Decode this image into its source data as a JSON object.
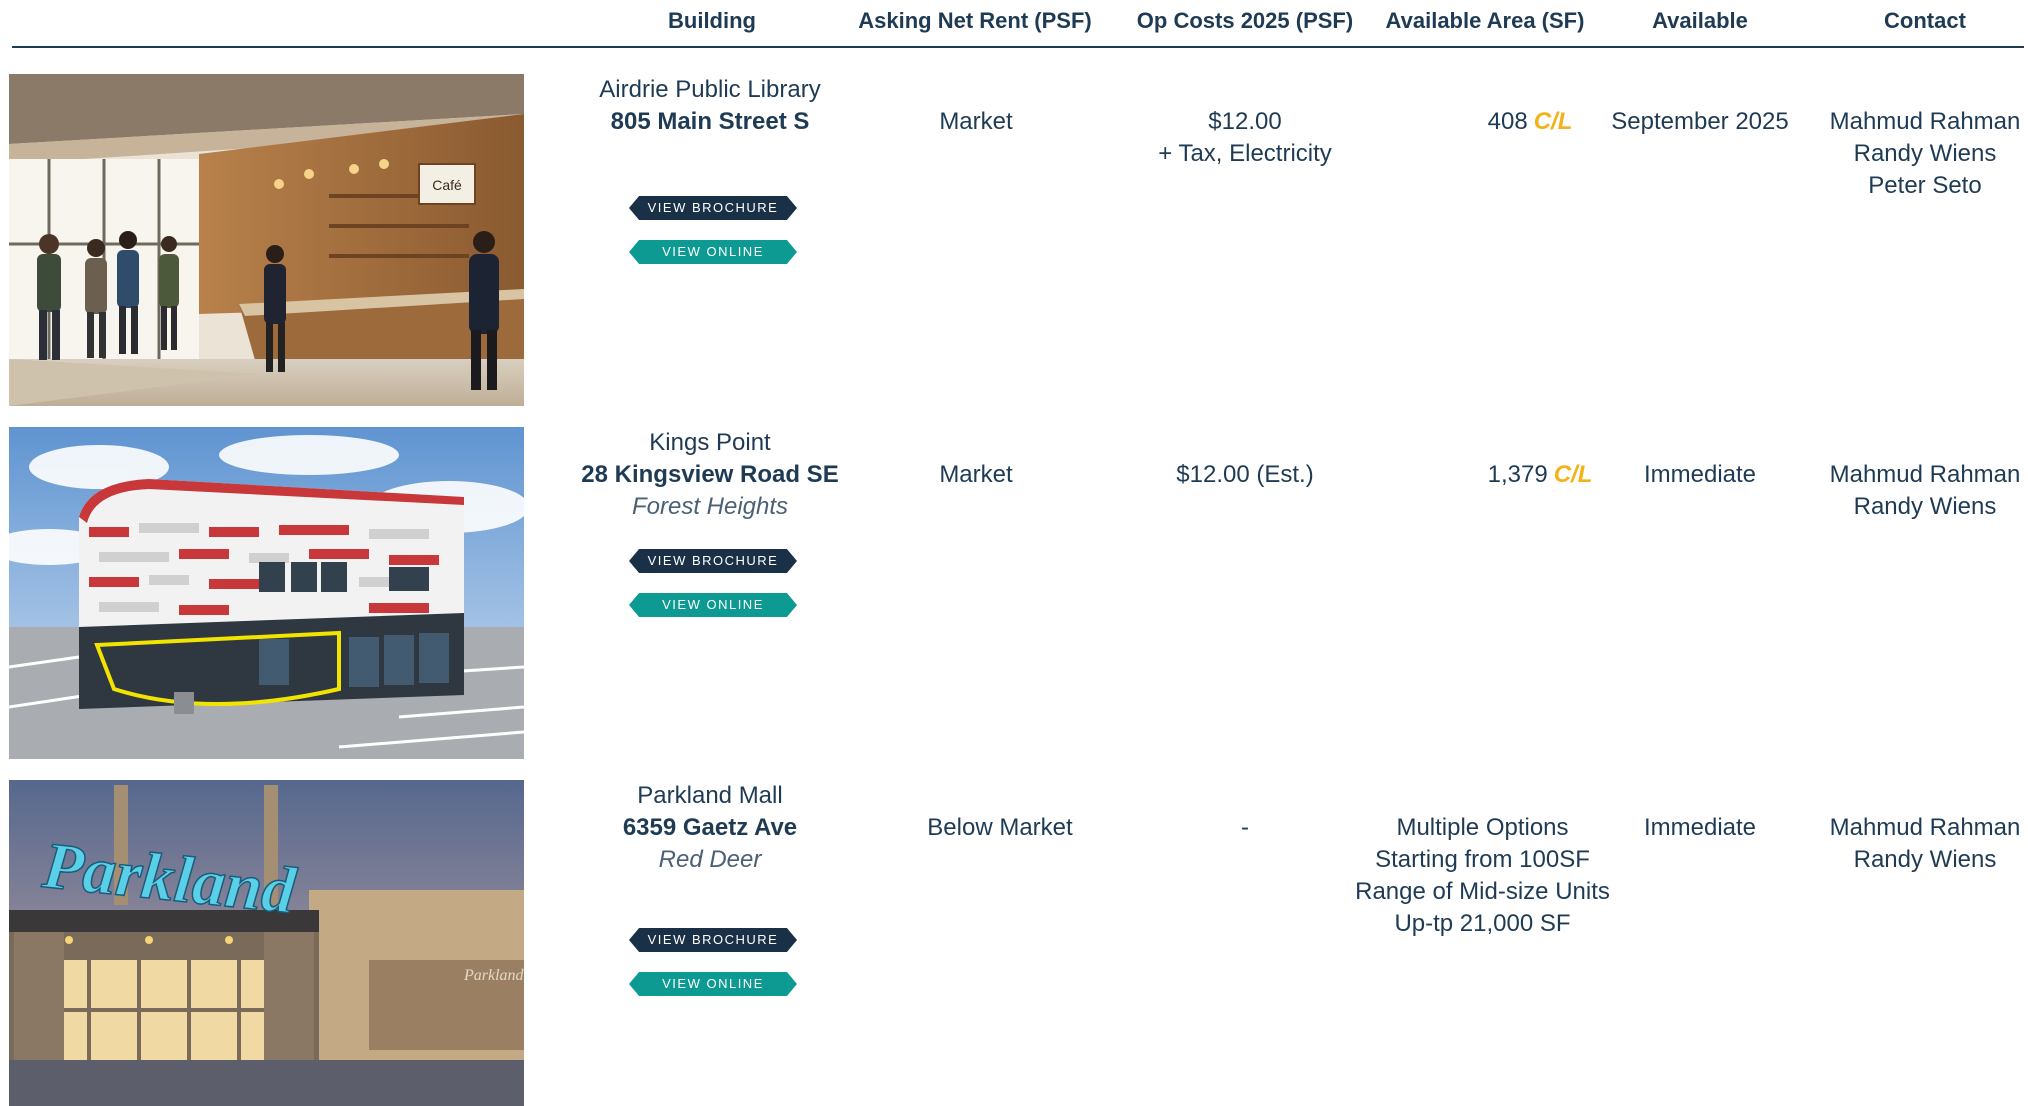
{
  "header": {
    "building": "Building",
    "rent": "Asking Net Rent (PSF)",
    "opcosts": "Op Costs 2025 (PSF)",
    "area": "Available Area (SF)",
    "available": "Available",
    "contact": "Contact"
  },
  "buttons": {
    "brochure": "VIEW BROCHURE",
    "online": "VIEW ONLINE"
  },
  "cl_badge": "C/L",
  "photo_text": {
    "parkland_sign": "Parkland",
    "cafe_sign": "Café"
  },
  "listings": [
    {
      "name": "Airdrie Public Library",
      "address": "805 Main Street S",
      "area_name": "",
      "rent": "Market",
      "opcost_1": "$12.00",
      "opcost_2": "+ Tax, Electricity",
      "area_sf": "408",
      "available": "September 2025",
      "contacts": [
        "Mahmud Rahman",
        "Randy Wiens",
        "Peter Seto"
      ]
    },
    {
      "name": "Kings Point",
      "address": "28 Kingsview Road SE",
      "area_name": "Forest Heights",
      "rent": "Market",
      "opcost_1": "$12.00 (Est.)",
      "opcost_2": "",
      "area_sf": "1,379",
      "available": "Immediate",
      "contacts": [
        "Mahmud Rahman",
        "Randy Wiens"
      ]
    },
    {
      "name": "Parkland Mall",
      "address": "6359 Gaetz Ave",
      "area_name": "Red Deer",
      "rent": "Below Market",
      "opcost_1": "-",
      "opcost_2": "",
      "area_lines": [
        "Multiple Options",
        "Starting from 100SF",
        "Range of Mid-size Units",
        "Up-tp 21,000 SF"
      ],
      "available": "Immediate",
      "contacts": [
        "Mahmud Rahman",
        "Randy Wiens"
      ]
    }
  ],
  "colors": {
    "navy": "#1f3b54",
    "teal": "#0d9a92",
    "cl_yellow": "#f3b21a"
  }
}
